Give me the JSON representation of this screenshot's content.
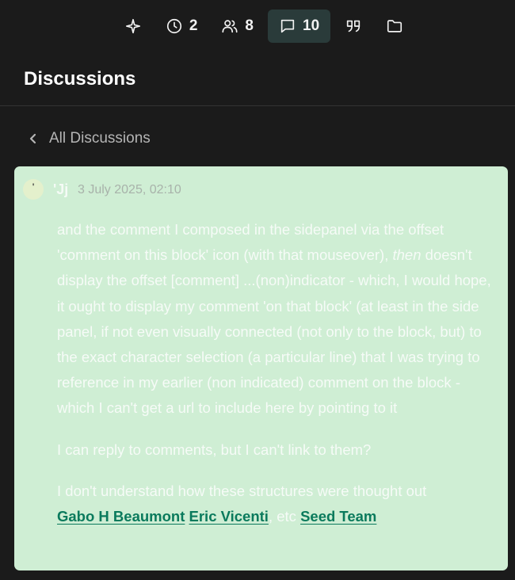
{
  "toolbar": {
    "sparkle_icon": "sparkle-icon",
    "history_count": "2",
    "people_count": "8",
    "comments_count": "10",
    "quote_icon": "quote-icon",
    "folder_icon": "folder-icon",
    "active_color": "#2a3b3a"
  },
  "header": {
    "title": "Discussions"
  },
  "back": {
    "label": "All Discussions"
  },
  "comment": {
    "avatar_initial": "'",
    "author": "'Jj",
    "date": "3 July 2025, 02:10",
    "paragraph_1": "and the comment I composed in the sidepanel via the offset 'comment on this block' icon (with that mouseover),",
    "paragraph_1_em": "then",
    "paragraph_1_rest": "doesn't display the offset [comment] ...(non)indicator - which, I would hope, it ought to display my comment 'on that block' (at least in the side panel, if not even visually connected (not only to the block, but) to the exact character selection (a particular line) that I was trying to reference in my earlier (non indicated) comment on the block - which I can't get a url to include here by pointing to it",
    "paragraph_2": "I can reply to comments, but I can't link to them?",
    "paragraph_3": "I don't understand how these structures were thought out",
    "mention_1": "Gabo H Beaumont",
    "mention_2": "Eric Vicenti",
    "etc": ", etc",
    "mention_3": "Seed Team",
    "card_color": "#cfeed4",
    "mention_color": "#0a7a5c"
  }
}
